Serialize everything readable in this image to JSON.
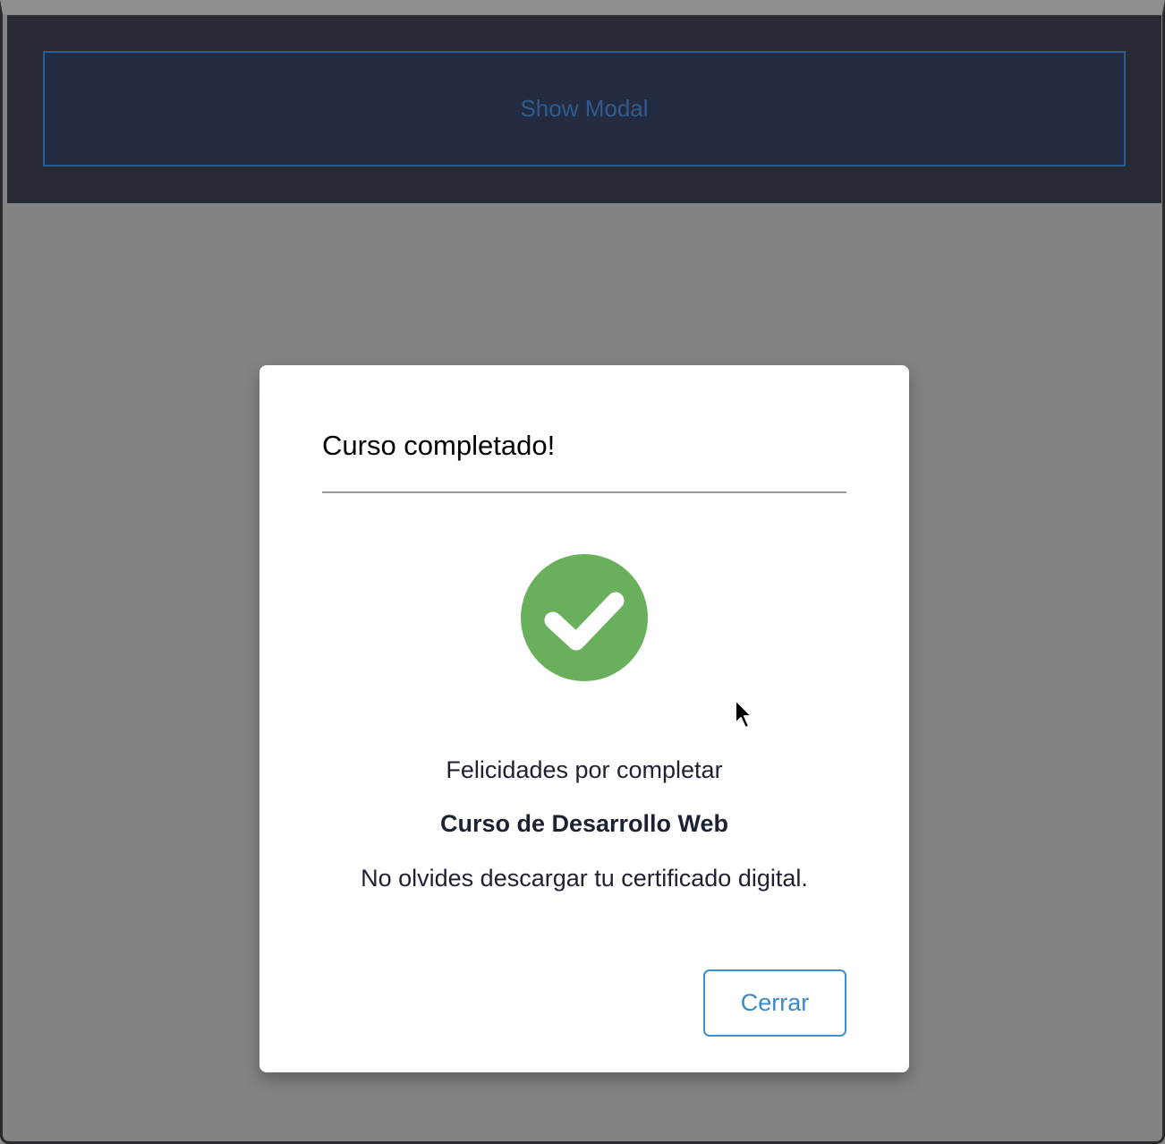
{
  "top": {
    "show_modal_label": "Show Modal"
  },
  "modal": {
    "title": "Curso completado!",
    "icon": "check-circle-icon",
    "line1": "Felicidades por completar",
    "line2": "Curso de Desarrollo Web",
    "line3": "No olvides descargar tu certificado digital.",
    "close_label": "Cerrar"
  },
  "colors": {
    "overlay": "#838383",
    "top_bar": "#282a33",
    "success_green": "#6aaf5c",
    "accent_blue": "#3a8ac9"
  }
}
